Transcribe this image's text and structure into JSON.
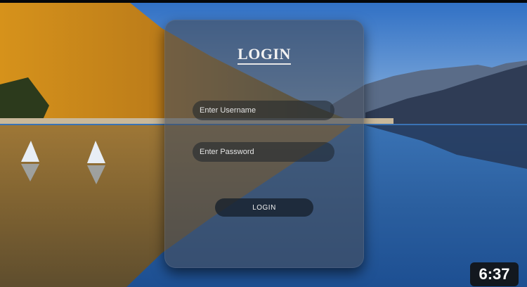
{
  "login": {
    "title": "LOGIN",
    "username_placeholder": "Enter Username",
    "password_placeholder": "Enter Password",
    "button_label": "LOGIN"
  },
  "video": {
    "duration": "6:37"
  },
  "background": {
    "sky_color": "#4f86c6",
    "water_color": "#2e6aa8",
    "forest_color": "#c88a1a",
    "mountain_color": "#3d4e68"
  }
}
